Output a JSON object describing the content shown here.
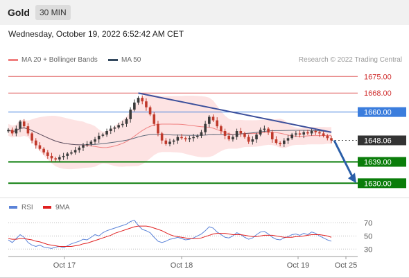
{
  "header": {
    "instrument": "Gold",
    "timeframe": "30 MIN",
    "timestamp": "Wednesday, October 19, 2022 6:52:42 AM CET"
  },
  "legend": {
    "ma20_label": "MA 20 + Bollinger Bands",
    "ma50_label": "MA 50",
    "credit": "Research © 2022 Trading Central"
  },
  "rsi_legend": {
    "rsi_label": "RSI",
    "ma_label": "9MA"
  },
  "colors": {
    "bull_candle": "#3a3a3a",
    "bear_candle": "#c0392b",
    "ma20": "#f08080",
    "bollinger_fill": "#fde0e0",
    "ma50": "#34495e",
    "trendline": "#3b4f9b",
    "resistance": "#e06060",
    "pivot": "#3b7ddd",
    "support": "#0a7d0a",
    "current": "#333333",
    "rsi": "#5b83d8",
    "rsi_ma": "#e02020"
  },
  "chart_data": [
    {
      "type": "candlestick",
      "x_labels": [
        "Oct 17",
        "Oct 18",
        "Oct 19",
        "Oct 25"
      ],
      "ylim": [
        1626,
        1678
      ],
      "price_levels": [
        {
          "label": "1675.00",
          "value": 1675.0,
          "kind": "resistance"
        },
        {
          "label": "1668.00",
          "value": 1668.0,
          "kind": "resistance"
        },
        {
          "label": "1660.00",
          "value": 1660.0,
          "kind": "pivot"
        },
        {
          "label": "1648.06",
          "value": 1648.06,
          "kind": "current"
        },
        {
          "label": "1639.00",
          "value": 1639.0,
          "kind": "support"
        },
        {
          "label": "1630.00",
          "value": 1630.0,
          "kind": "support"
        }
      ],
      "close_series": [
        1652.5,
        1651.0,
        1653.0,
        1656.0,
        1654.0,
        1651.0,
        1648.0,
        1646.0,
        1644.5,
        1643.0,
        1641.5,
        1640.5,
        1640.0,
        1641.0,
        1641.5,
        1642.5,
        1643.0,
        1644.0,
        1645.0,
        1646.0,
        1646.5,
        1647.5,
        1648.5,
        1650.0,
        1650.5,
        1652.0,
        1653.0,
        1653.5,
        1654.5,
        1655.0,
        1657.0,
        1661.0,
        1664.0,
        1666.0,
        1664.5,
        1662.0,
        1659.0,
        1655.0,
        1651.0,
        1648.0,
        1646.5,
        1647.5,
        1648.0,
        1649.5,
        1649.0,
        1648.5,
        1649.0,
        1649.5,
        1650.0,
        1651.5,
        1655.0,
        1658.0,
        1656.5,
        1654.0,
        1652.0,
        1650.0,
        1648.5,
        1649.5,
        1652.0,
        1651.0,
        1649.5,
        1647.5,
        1648.5,
        1650.5,
        1652.5,
        1653.0,
        1651.5,
        1648.5,
        1647.0,
        1646.5,
        1648.0,
        1649.0,
        1650.5,
        1651.0,
        1650.5,
        1651.5,
        1651.0,
        1652.0,
        1651.5,
        1651.0,
        1650.0,
        1649.0,
        1648.06
      ],
      "trendline": {
        "start": {
          "index": 33,
          "value": 1668.0
        },
        "end": {
          "index": 82,
          "value": 1651.5
        }
      },
      "projection": {
        "start": 1648.06,
        "end": 1630.0
      }
    },
    {
      "type": "line",
      "title": "RSI",
      "ylim": [
        25,
        80
      ],
      "y_ticks": [
        70,
        50,
        30
      ],
      "series": [
        {
          "name": "RSI",
          "values": [
            44,
            40,
            46,
            52,
            48,
            40,
            36,
            34,
            36,
            33,
            32,
            31,
            33,
            34,
            32,
            35,
            38,
            40,
            42,
            45,
            44,
            48,
            52,
            50,
            55,
            58,
            60,
            62,
            64,
            66,
            68,
            72,
            74,
            66,
            60,
            58,
            55,
            48,
            42,
            40,
            42,
            45,
            46,
            48,
            46,
            44,
            45,
            47,
            50,
            53,
            58,
            64,
            62,
            56,
            52,
            48,
            47,
            50,
            55,
            52,
            48,
            45,
            47,
            52,
            56,
            57,
            53,
            48,
            45,
            44,
            47,
            49,
            52,
            53,
            51,
            54,
            52,
            56,
            54,
            50,
            47,
            44,
            42
          ]
        },
        {
          "name": "9MA",
          "values": [
            46,
            45,
            45,
            46,
            46,
            45,
            44,
            42,
            41,
            39,
            37,
            36,
            35,
            34,
            34,
            34,
            34,
            35,
            36,
            38,
            39,
            41,
            43,
            45,
            47,
            49,
            51,
            54,
            56,
            58,
            60,
            62,
            64,
            65,
            65,
            65,
            64,
            62,
            60,
            58,
            55,
            52,
            50,
            49,
            48,
            47,
            46,
            46,
            46,
            47,
            49,
            51,
            53,
            54,
            54,
            54,
            53,
            52,
            52,
            52,
            51,
            50,
            49,
            49,
            50,
            51,
            51,
            51,
            50,
            49,
            48,
            48,
            48,
            49,
            49,
            50,
            51,
            52,
            52,
            52,
            51,
            50,
            48
          ]
        }
      ]
    }
  ]
}
